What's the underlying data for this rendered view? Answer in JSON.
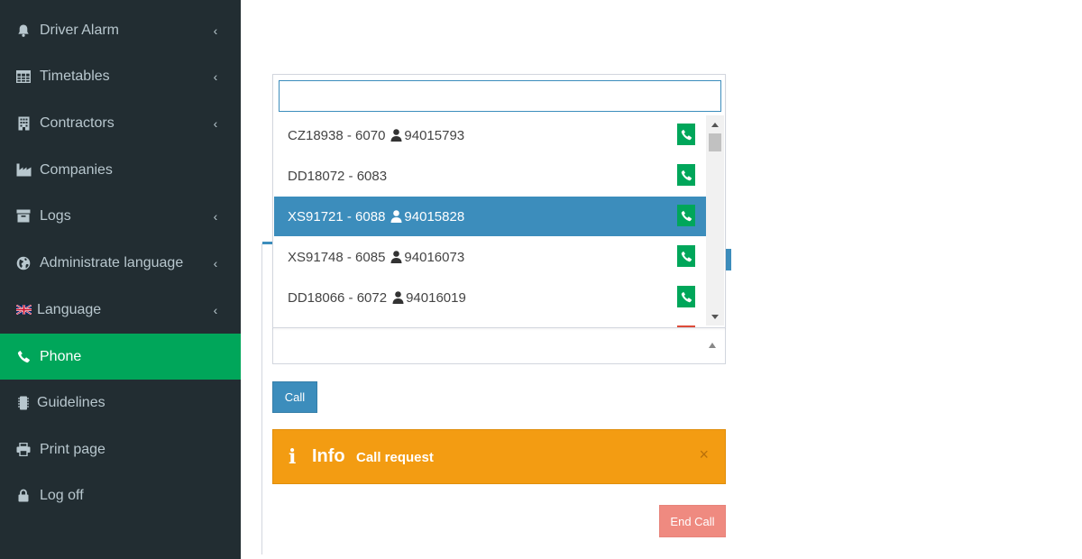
{
  "sidebar": {
    "items": [
      {
        "label": "Driver Alarm",
        "icon": "bell-icon",
        "has_submenu": true
      },
      {
        "label": "Timetables",
        "icon": "table-icon",
        "has_submenu": true
      },
      {
        "label": "Contractors",
        "icon": "building-icon",
        "has_submenu": true
      },
      {
        "label": "Companies",
        "icon": "industry-icon",
        "has_submenu": false
      },
      {
        "label": "Logs",
        "icon": "archive-icon",
        "has_submenu": true
      },
      {
        "label": "Administrate language",
        "icon": "globe-icon",
        "has_submenu": true
      },
      {
        "label": "Language",
        "icon": "uk-flag-icon",
        "has_submenu": true
      },
      {
        "label": "Phone",
        "icon": "phone-icon",
        "has_submenu": false,
        "active": true
      },
      {
        "label": "Guidelines",
        "icon": "microchip-icon",
        "has_submenu": false
      },
      {
        "label": "Print page",
        "icon": "print-icon",
        "has_submenu": false
      },
      {
        "label": "Log off",
        "icon": "lock-icon",
        "has_submenu": false
      }
    ],
    "colors": {
      "background": "#222d32",
      "active": "#00a65a",
      "text": "#b8c7ce"
    }
  },
  "dropdown": {
    "search_value": "",
    "options": [
      {
        "code": "CZ18938 - 6070",
        "phone": "94015793",
        "selected": false
      },
      {
        "code": "DD18072 - 6083",
        "phone": "",
        "selected": false
      },
      {
        "code": "XS91721 - 6088",
        "phone": "94015828",
        "selected": true
      },
      {
        "code": "XS91748 - 6085",
        "phone": "94016073",
        "selected": false
      },
      {
        "code": "DD18066 - 6072",
        "phone": "94016019",
        "selected": false
      }
    ]
  },
  "buttons": {
    "call": "Call",
    "end_call": "End Call"
  },
  "alert": {
    "icon": "i",
    "title": "Info",
    "message": "Call request",
    "close": "×"
  },
  "colors": {
    "primary": "#3c8dbc",
    "success": "#00a65a",
    "warning": "#f39c12",
    "danger_light": "#ef8a80"
  }
}
